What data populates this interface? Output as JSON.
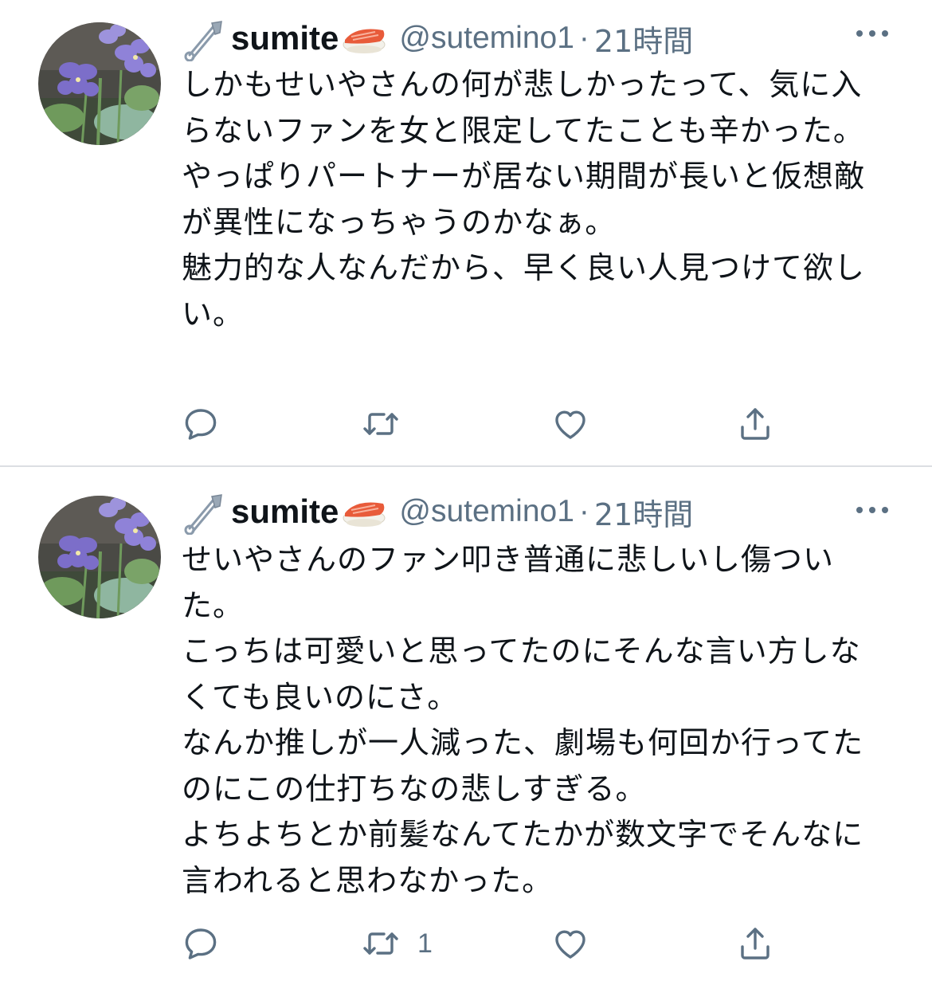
{
  "colors": {
    "text": "#0f1419",
    "secondary": "#5b7083",
    "divider": "#dcdfe3",
    "background": "#ffffff"
  },
  "tweets": [
    {
      "display_name": "sumite",
      "handle": "@sutemino1",
      "separator": "·",
      "time": "21時間",
      "icons": [
        "safety-pin-icon",
        "sushi-icon",
        "more-icon"
      ],
      "text": "しかもせいやさんの何が悲しかったって、気に入らないファンを女と限定してたことも辛かった。\nやっぱりパートナーが居ない期間が長いと仮想敵が異性になっちゃうのかなぁ。\n魅力的な人なんだから、早く良い人見つけて欲しい。",
      "actions": {
        "reply_count": "",
        "retweet_count": "",
        "like_count": ""
      }
    },
    {
      "display_name": "sumite",
      "handle": "@sutemino1",
      "separator": "·",
      "time": "21時間",
      "icons": [
        "safety-pin-icon",
        "sushi-icon",
        "more-icon"
      ],
      "text": "せいやさんのファン叩き普通に悲しいし傷ついた。\nこっちは可愛いと思ってたのにそんな言い方しなくても良いのにさ。\nなんか推しが一人減った、劇場も何回か行ってたのにこの仕打ちなの悲しすぎる。\nよちよちとか前髪なんてたかが数文字でそんなに言われると思わなかった。",
      "actions": {
        "reply_count": "",
        "retweet_count": "1",
        "like_count": ""
      }
    }
  ]
}
